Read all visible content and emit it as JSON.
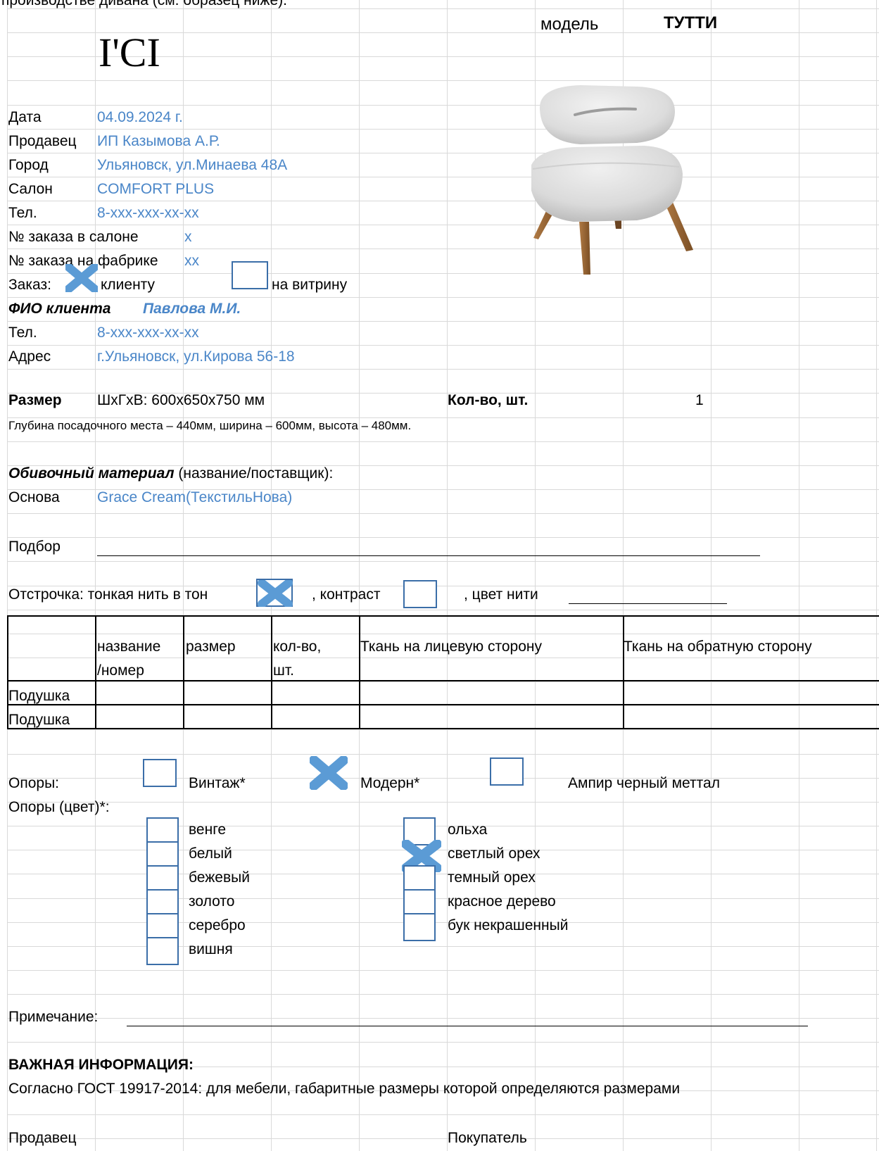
{
  "intro_text": "производстве дивана (см. образец ниже).",
  "header": {
    "logo": "I'CI",
    "model_label": "модель",
    "model_name": "ТУТТИ"
  },
  "order": {
    "date_label": "Дата",
    "date_value": "04.09.2024 г.",
    "seller_label": "Продавец",
    "seller_value": "ИП Казымова А.Р.",
    "city_label": "Город",
    "city_value": "Ульяновск, ул.Минаева 48А",
    "salon_label": "Салон",
    "salon_value": "COMFORT PLUS",
    "phone_label": "Тел.",
    "phone_value": "8-xxx-xxx-xx-xx",
    "salon_order_label": "№ заказа в салоне",
    "salon_order_value": "x",
    "factory_order_label": "№ заказа на фабрике",
    "factory_order_value": "xx",
    "order_for_label": "Заказ:",
    "order_for_client": "клиенту",
    "order_for_client_checked": true,
    "order_for_showcase": "на витрину",
    "order_for_showcase_checked": false
  },
  "client": {
    "name_label": "ФИО клиента",
    "name_value": "Павлова М.И.",
    "phone_label": "Тел.",
    "phone_value": "8-xxx-xxx-xx-xx",
    "address_label": "Адрес",
    "address_value": "г.Ульяновск, ул.Кирова 56-18"
  },
  "size": {
    "label": "Размер",
    "value": "ШхГхВ: 600х650х750 мм",
    "qty_label": "Кол-во, шт.",
    "qty_value": "1",
    "seat_info": "Глубина посадочного места – 440мм, ширина – 600мм, высота – 480мм."
  },
  "upholstery": {
    "title": "Обивочный материал",
    "title_note": " (название/поставщик):",
    "base_label": "Основа",
    "base_value": "Grace Cream(ТекстильНова)",
    "match_label": "Подбор"
  },
  "stitching": {
    "label": "Отстрочка:  тонкая нить в тон",
    "tone_checked": true,
    "contrast_label": ", контраст",
    "contrast_checked": false,
    "color_label": ", цвет нити"
  },
  "pillows": {
    "headers": [
      "",
      "название /номер",
      "размер",
      "кол-во, шт.",
      "Ткань на лицевую сторону",
      "Ткань на обратную сторону"
    ],
    "header_lines": {
      "name_1": "название",
      "name_2": "/номер",
      "qty_1": "кол-во,",
      "qty_2": "шт."
    },
    "rows": [
      {
        "label": "Подушка"
      },
      {
        "label": "Подушка"
      }
    ]
  },
  "legs": {
    "label": "Опоры:",
    "options": [
      {
        "label": "Винтаж*",
        "checked": false
      },
      {
        "label": "Модерн*",
        "checked": true
      },
      {
        "label": "Ампир черный меттал",
        "checked": false
      }
    ],
    "color_label": "Опоры (цвет)*:",
    "colors_left": [
      {
        "label": "венге",
        "checked": false
      },
      {
        "label": "белый",
        "checked": false
      },
      {
        "label": "бежевый",
        "checked": false
      },
      {
        "label": "золото",
        "checked": false
      },
      {
        "label": "серебро",
        "checked": false
      },
      {
        "label": "вишня",
        "checked": false
      }
    ],
    "colors_right": [
      {
        "label": "ольха",
        "checked": false
      },
      {
        "label": "светлый орех",
        "checked": true
      },
      {
        "label": "темный орех",
        "checked": false
      },
      {
        "label": "красное дерево",
        "checked": false
      },
      {
        "label": "бук некрашенный",
        "checked": false
      }
    ]
  },
  "notes": {
    "label": "Примечание:"
  },
  "important": {
    "title": "ВАЖНАЯ  ИНФОРМАЦИЯ:",
    "text": "Согласно ГОСТ 19917-2014: для мебели, габаритные размеры которой определяются размерами"
  },
  "footer": {
    "seller": "Продавец",
    "buyer": "Покупатель"
  },
  "colors": {
    "accent": "#4a86c8",
    "checkbox": "#3b6ea8",
    "check_mark": "#5b9bd5",
    "grid": "#d9d9d9"
  }
}
